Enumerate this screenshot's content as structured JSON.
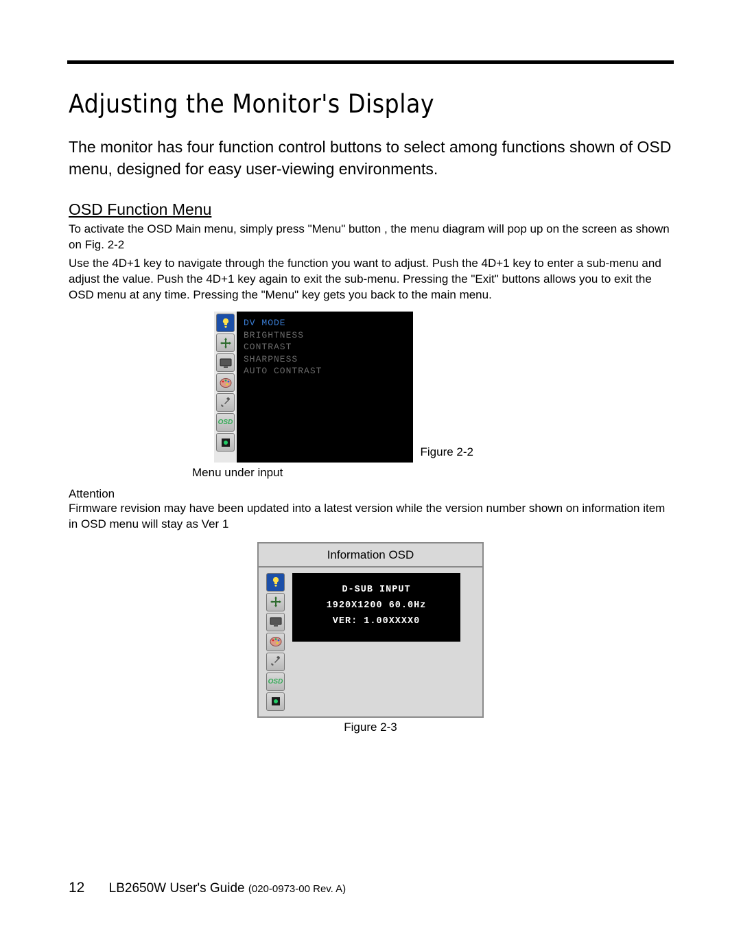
{
  "headerRule": true,
  "heading1": "Adjusting the Monitor's Display",
  "intro": "The monitor has four function control buttons to select among functions shown of OSD menu, designed for easy user-viewing environments.",
  "heading2": "OSD Function Menu",
  "osdPara1": "To activate the OSD Main menu, simply press \"Menu\" button , the menu diagram will pop up on the screen as shown on Fig. 2-2",
  "osdPara2": "Use the 4D+1 key to navigate through the function you want to adjust. Push the 4D+1 key to enter a sub-menu and adjust the value. Push the 4D+1 key again to exit the sub-menu. Pressing the \"Exit\" buttons allows you to exit the OSD menu at any time. Pressing the \"Menu\" key gets you back to the main menu.",
  "osdMenu1": {
    "items": [
      "DV MODE",
      "BRIGHTNESS",
      "CONTRAST",
      "SHARPNESS",
      "AUTO CONTRAST"
    ],
    "highlightIndex": 0
  },
  "figure1Caption": "Figure 2-2",
  "menuUnderInputCaption": "Menu under input",
  "attentionLabel": "Attention",
  "attentionText": "Firmware revision may have been updated into a latest version while the version number shown on information item in OSD menu will stay as Ver 1",
  "infoOsd": {
    "title": "Information OSD",
    "lines": [
      "D-SUB  INPUT",
      "1920X1200  60.0Hz",
      "VER:  1.00XXXX0"
    ]
  },
  "figure2Caption": "Figure 2-3",
  "footer": {
    "page": "12",
    "guide": "LB2650W User's Guide",
    "rev": "(020-0973-00 Rev. A)"
  },
  "icons": {
    "bulb": "bulb-icon",
    "move": "move-icon",
    "screen": "screen-icon",
    "palette": "palette-icon",
    "tools": "tools-icon",
    "osd": "osd-icon",
    "dot": "dot-icon"
  }
}
